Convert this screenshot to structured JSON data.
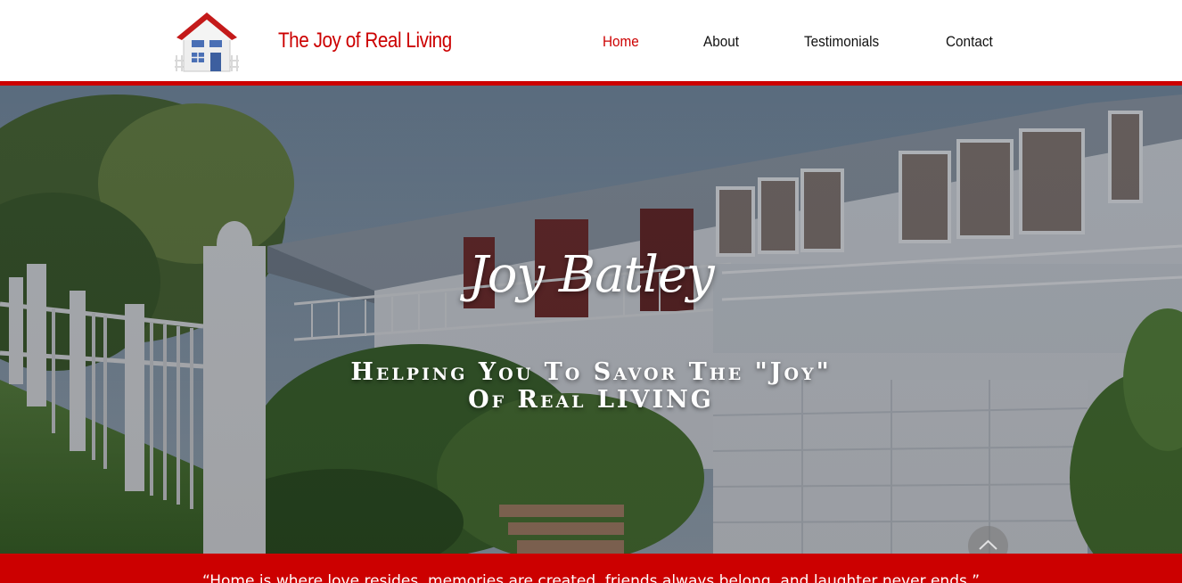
{
  "header": {
    "brand_title": "The Joy of Real Living",
    "logo_icon": "house-icon"
  },
  "nav": {
    "items": [
      {
        "label": "Home",
        "active": true
      },
      {
        "label": "About",
        "active": false
      },
      {
        "label": "Testimonials",
        "active": false
      },
      {
        "label": "Contact",
        "active": false
      }
    ]
  },
  "hero": {
    "name": "Joy Batley",
    "tagline_line1": "Helping You To Savor The \"Joy\"",
    "tagline_line2": "Of Real LIVING",
    "background_icon": "house-photo"
  },
  "scroll_top": {
    "icon": "chevron-up-icon"
  },
  "quote": {
    "text": "“Home is where love resides, memories are created, friends always belong, and laughter never ends.”"
  },
  "colors": {
    "accent": "#cc0000",
    "header_bg": "#ffffff",
    "nav_text": "#111111"
  }
}
